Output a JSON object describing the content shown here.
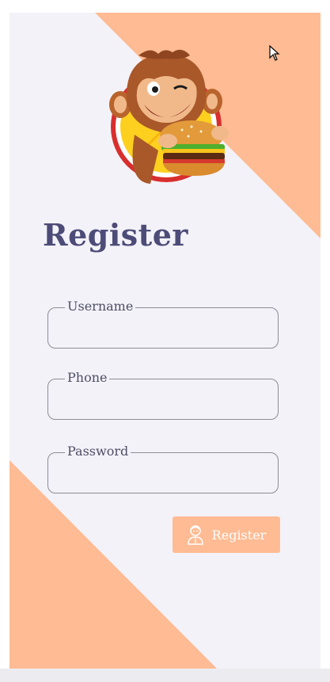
{
  "form": {
    "title": "Register",
    "fields": [
      {
        "label": "Username",
        "value": ""
      },
      {
        "label": "Phone",
        "value": ""
      },
      {
        "label": "Password",
        "value": ""
      }
    ],
    "submit_label": "Register",
    "submit_icon": "user-icon"
  },
  "colors": {
    "accent": "#ffbb93",
    "title": "#4d4c78",
    "background": "#f3f2f8"
  },
  "logo": {
    "description_icon": "monkey-burger-logo"
  }
}
